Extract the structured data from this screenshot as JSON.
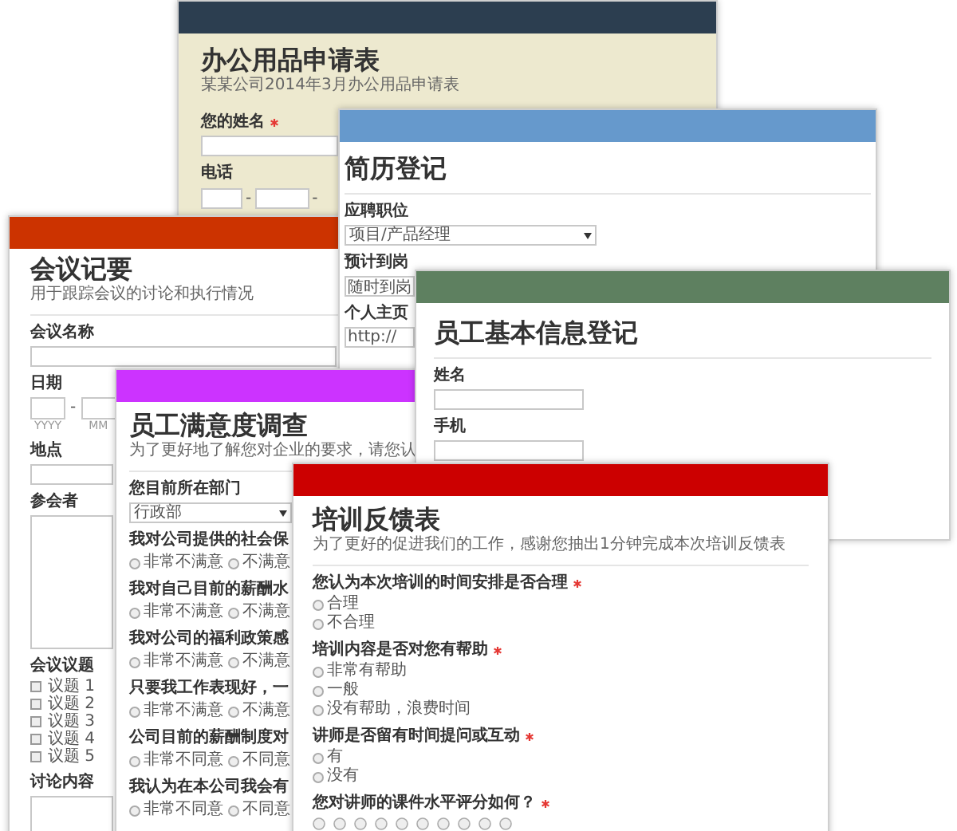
{
  "forms": [
    {
      "title": "办公用品申请表",
      "subtitle": "某某公司2014年3月办公用品申请表",
      "color": "#2c3e50",
      "fields": [
        {
          "kind": "text",
          "label": "您的姓名",
          "required": true
        },
        {
          "kind": "phone",
          "label": "电话",
          "separator": "-"
        }
      ]
    },
    {
      "title": "会议记要",
      "subtitle": "用于跟踪会议的讨论和执行情况",
      "color": "#cc3300",
      "fields": [
        {
          "kind": "text",
          "label": "会议名称"
        },
        {
          "kind": "date",
          "label": "日期",
          "separator": "-",
          "parts": [
            "YYYY",
            "MM"
          ]
        },
        {
          "kind": "text",
          "label": "地点"
        },
        {
          "kind": "textarea",
          "label": "参会者"
        },
        {
          "kind": "checkboxes",
          "label": "会议议题",
          "options": [
            {
              "label": "议题 1",
              "checked": false
            },
            {
              "label": "议题 2",
              "checked": false
            },
            {
              "label": "议题 3",
              "checked": false
            },
            {
              "label": "议题 4",
              "checked": false
            },
            {
              "label": "议题 5",
              "checked": false
            }
          ]
        },
        {
          "kind": "textarea",
          "label": "讨论内容"
        }
      ]
    },
    {
      "title": "简历登记",
      "color": "#6699cc",
      "fields": [
        {
          "kind": "select",
          "label": "应聘职位",
          "value": "项目/产品经理"
        },
        {
          "kind": "text",
          "label": "预计到岗",
          "value": "随时到岗"
        },
        {
          "kind": "text",
          "label": "个人主页",
          "value": "http://"
        }
      ]
    },
    {
      "title": "员工满意度调查",
      "subtitle": "为了更好地了解您对企业的要求，请您认",
      "color": "#cc33ff",
      "fields": [
        {
          "kind": "select",
          "label": "您目前所在部门",
          "value": "行政部"
        },
        {
          "kind": "radios",
          "label": "我对公司提供的社会保",
          "options": [
            {
              "label": "非常不满意",
              "selected": false
            },
            {
              "label": "不满意",
              "selected": false
            }
          ]
        },
        {
          "kind": "radios",
          "label": "我对自己目前的薪酬水",
          "options": [
            {
              "label": "非常不满意",
              "selected": false
            },
            {
              "label": "不满意",
              "selected": false
            }
          ]
        },
        {
          "kind": "radios",
          "label": "我对公司的福利政策感",
          "options": [
            {
              "label": "非常不满意",
              "selected": false
            },
            {
              "label": "不满意",
              "selected": false
            }
          ]
        },
        {
          "kind": "radios",
          "label": "只要我工作表现好，一",
          "options": [
            {
              "label": "非常不满意",
              "selected": false
            },
            {
              "label": "不满意",
              "selected": false
            }
          ]
        },
        {
          "kind": "radios",
          "label": "公司目前的薪酬制度对",
          "options": [
            {
              "label": "非常不同意",
              "selected": false
            },
            {
              "label": "不同意",
              "selected": false
            }
          ]
        },
        {
          "kind": "radios",
          "label": "我认为在本公司我会有",
          "options": [
            {
              "label": "非常不同意",
              "selected": false
            },
            {
              "label": "不同意",
              "selected": false
            }
          ]
        }
      ]
    },
    {
      "title": "员工基本信息登记",
      "color": "#5e8060",
      "fields": [
        {
          "kind": "text",
          "label": "姓名"
        },
        {
          "kind": "text",
          "label": "手机"
        }
      ]
    },
    {
      "title": "培训反馈表",
      "subtitle": "为了更好的促进我们的工作，感谢您抽出1分钟完成本次培训反馈表",
      "color": "#cc0000",
      "fields": [
        {
          "kind": "radios",
          "label": "您认为本次培训的时间安排是否合理",
          "required": true,
          "options": [
            {
              "label": "合理",
              "selected": false
            },
            {
              "label": "不合理",
              "selected": false
            }
          ]
        },
        {
          "kind": "radios",
          "label": "培训内容是否对您有帮助",
          "required": true,
          "options": [
            {
              "label": "非常有帮助",
              "selected": false
            },
            {
              "label": "一般",
              "selected": false
            },
            {
              "label": "没有帮助，浪费时间",
              "selected": false
            }
          ]
        },
        {
          "kind": "radios",
          "label": "讲师是否留有时间提问或互动",
          "required": true,
          "options": [
            {
              "label": "有",
              "selected": false
            },
            {
              "label": "没有",
              "selected": false
            }
          ]
        },
        {
          "kind": "rating",
          "label": "您对讲师的课件水平评分如何？",
          "required": true
        }
      ]
    }
  ]
}
